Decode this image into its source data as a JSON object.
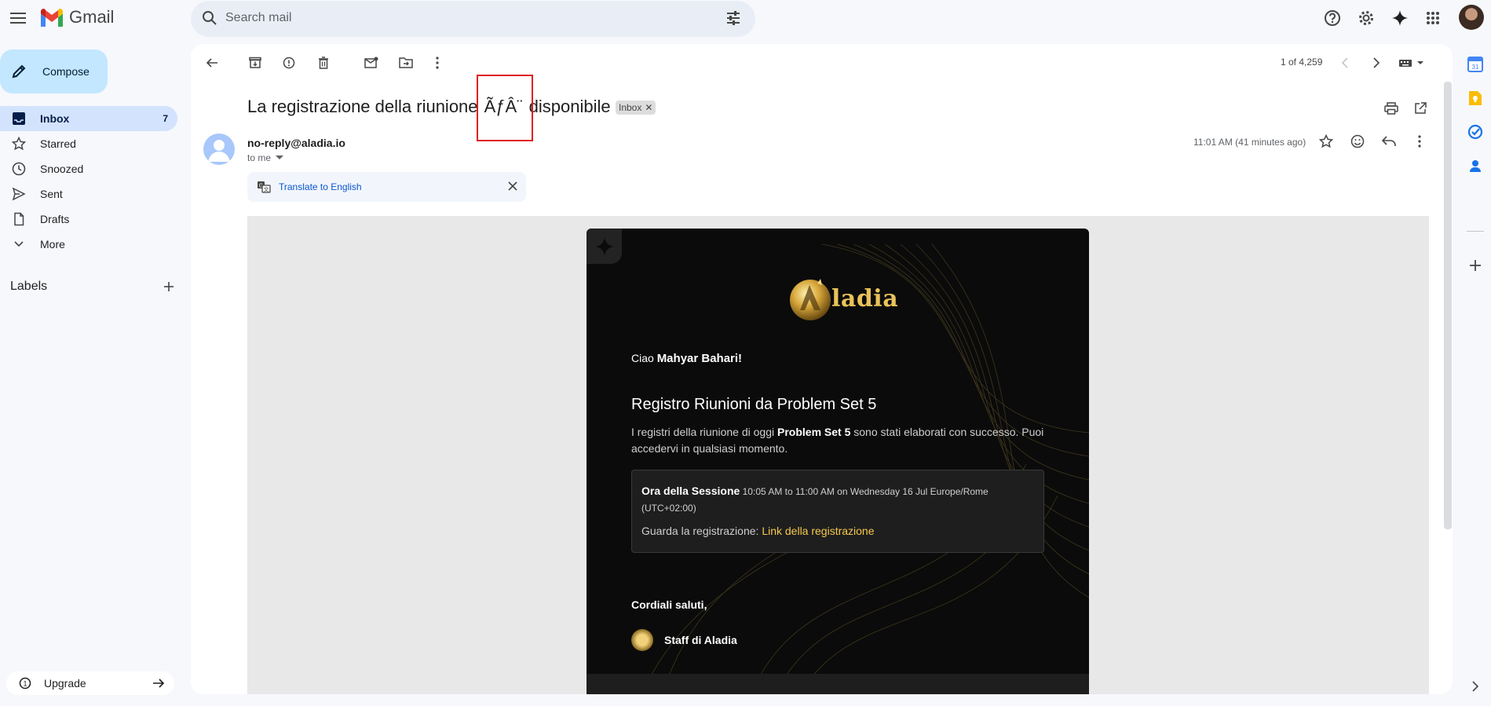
{
  "app": {
    "name": "Gmail"
  },
  "search": {
    "placeholder": "Search mail"
  },
  "compose": {
    "label": "Compose"
  },
  "nav": {
    "items": [
      {
        "label": "Inbox",
        "count": "7"
      },
      {
        "label": "Starred"
      },
      {
        "label": "Snoozed"
      },
      {
        "label": "Sent"
      },
      {
        "label": "Drafts"
      },
      {
        "label": "More"
      }
    ]
  },
  "labels": {
    "title": "Labels"
  },
  "upgrade": {
    "label": "Upgrade"
  },
  "pager": {
    "text": "1 of 4,259"
  },
  "email": {
    "subject_before": "La registrazione della riunione ",
    "subject_garbled": "ÃƒÂ¨",
    "subject_after": " disponibile",
    "label_chip": "Inbox",
    "sender": "no-reply@aladia.io",
    "to": "to me",
    "time": "11:01 AM (41 minutes ago)",
    "translate": "Translate to English"
  },
  "body": {
    "brand": "ladia",
    "greeting_prefix": "Ciao ",
    "greeting_name": "Mahyar Bahari!",
    "heading": "Registro Riunioni da Problem Set 5",
    "para_prefix": "I registri della riunione di oggi ",
    "para_bold": "Problem Set 5",
    "para_suffix": " sono stati elaborati con successo. Puoi accedervi in qualsiasi momento.",
    "session_label": "Ora della Sessione",
    "session_value": " 10:05 AM to 11:00 AM on Wednesday 16 Jul Europe/Rome (UTC+02:00)",
    "recording_prefix": "Guarda la registrazione: ",
    "recording_link": "Link della registrazione",
    "regards": "Cordiali saluti,",
    "staff": "Staff di Aladia"
  },
  "colors": {
    "accent_blue": "#0b57d0",
    "compose_bg": "#c2e7ff",
    "inbox_active": "#d3e3fd",
    "link_gold": "#f6c94e",
    "highlight_red": "#e02020"
  }
}
